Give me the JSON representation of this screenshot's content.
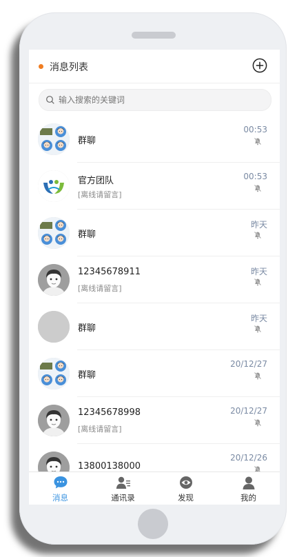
{
  "colors": {
    "accent": "#3a93e0",
    "header_dot": "#f07d21",
    "time_text": "#7a8aa3",
    "muted_icon": "#9a9a9a"
  },
  "header": {
    "title": "消息列表",
    "add_icon": "plus-circle-icon"
  },
  "search": {
    "placeholder": "输入搜索的关键词",
    "value": "",
    "icon": "search-icon"
  },
  "conversations": [
    {
      "name": "群聊",
      "preview": "",
      "time": "00:53",
      "avatar": "group-avatar",
      "muted": true
    },
    {
      "name": "官方团队",
      "preview": "[离线请留言]",
      "time": "00:53",
      "avatar": "team-logo-avatar",
      "muted": true
    },
    {
      "name": "群聊",
      "preview": "",
      "time": "昨天",
      "avatar": "group-avatar",
      "muted": true
    },
    {
      "name": "12345678911",
      "preview": "[离线请留言]",
      "time": "昨天",
      "avatar": "default-user-avatar",
      "muted": true
    },
    {
      "name": "群聊",
      "preview": "",
      "time": "昨天",
      "avatar": "blank-avatar",
      "muted": true
    },
    {
      "name": "群聊",
      "preview": "",
      "time": "20/12/27",
      "avatar": "group-avatar",
      "muted": true
    },
    {
      "name": "12345678998",
      "preview": "[离线请留言]",
      "time": "20/12/27",
      "avatar": "default-user-avatar",
      "muted": true
    },
    {
      "name": "13800138000",
      "preview": "",
      "time": "20/12/26",
      "avatar": "default-user-avatar",
      "muted": true
    }
  ],
  "tabbar": {
    "tabs": [
      {
        "label": "消息",
        "icon": "chat-bubble-icon",
        "active": true
      },
      {
        "label": "通讯录",
        "icon": "contacts-icon",
        "active": false
      },
      {
        "label": "发现",
        "icon": "eye-icon",
        "active": false
      },
      {
        "label": "我的",
        "icon": "person-icon",
        "active": false
      }
    ]
  }
}
